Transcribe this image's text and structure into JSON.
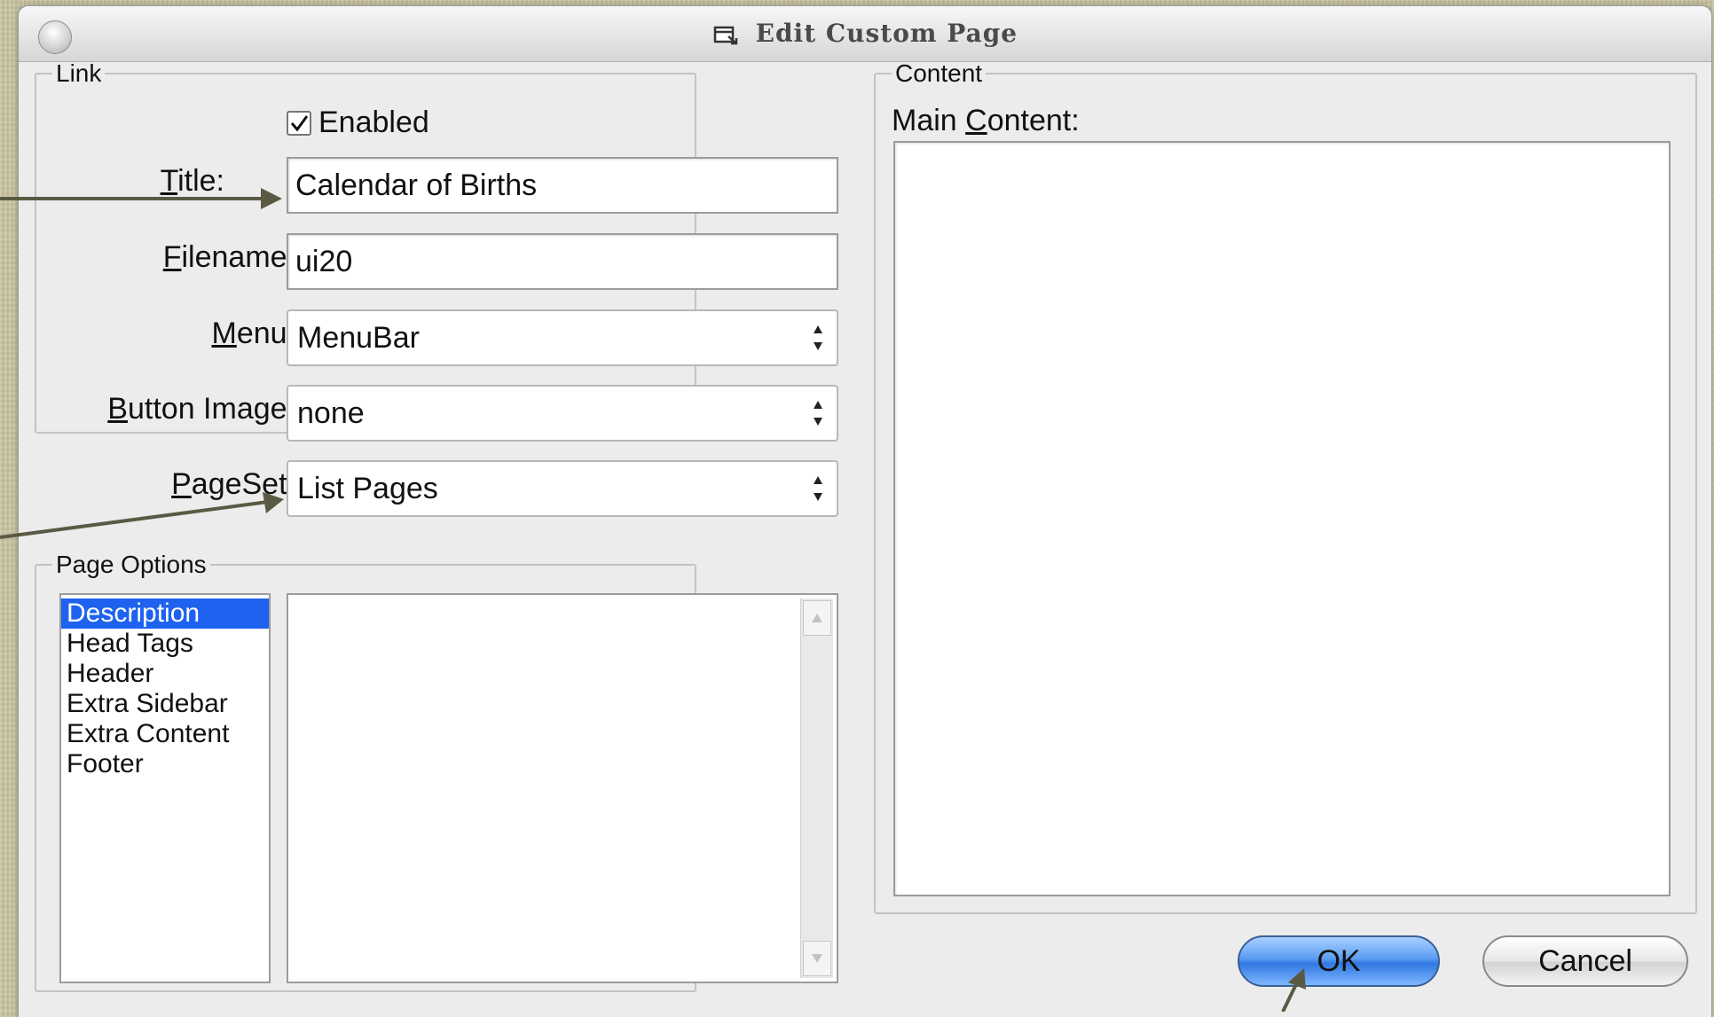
{
  "window": {
    "title": "Edit Custom Page"
  },
  "link_group": {
    "legend": "Link",
    "enabled": {
      "label": "Enabled",
      "checked": true
    },
    "title": {
      "label_before": "",
      "mnemonic": "T",
      "label_after": "itle:",
      "value": "Calendar of Births"
    },
    "filename": {
      "mnemonic": "F",
      "label_after": "ilename:",
      "value": "ui20"
    },
    "menu": {
      "mnemonic": "M",
      "label_after": "enu:",
      "value": "MenuBar"
    },
    "button_image": {
      "mnemonic": "B",
      "label_after": "utton Image:",
      "value": "none"
    },
    "pageset": {
      "mnemonic": "P",
      "label_after": "ageSet:",
      "value": "List Pages"
    }
  },
  "page_options": {
    "legend": "Page Options",
    "items": [
      "Description",
      "Head Tags",
      "Header",
      "Extra Sidebar",
      "Extra Content",
      "Footer"
    ],
    "selected_index": 0
  },
  "content_group": {
    "legend": "Content",
    "main_label_before": "Main ",
    "main_mnemonic": "C",
    "main_label_after": "ontent:"
  },
  "buttons": {
    "ok": "OK",
    "cancel": "Cancel"
  },
  "colors": {
    "selection": "#1f62f0",
    "arrow": "#5a5a44",
    "ok_button": "#5b9cf2"
  }
}
